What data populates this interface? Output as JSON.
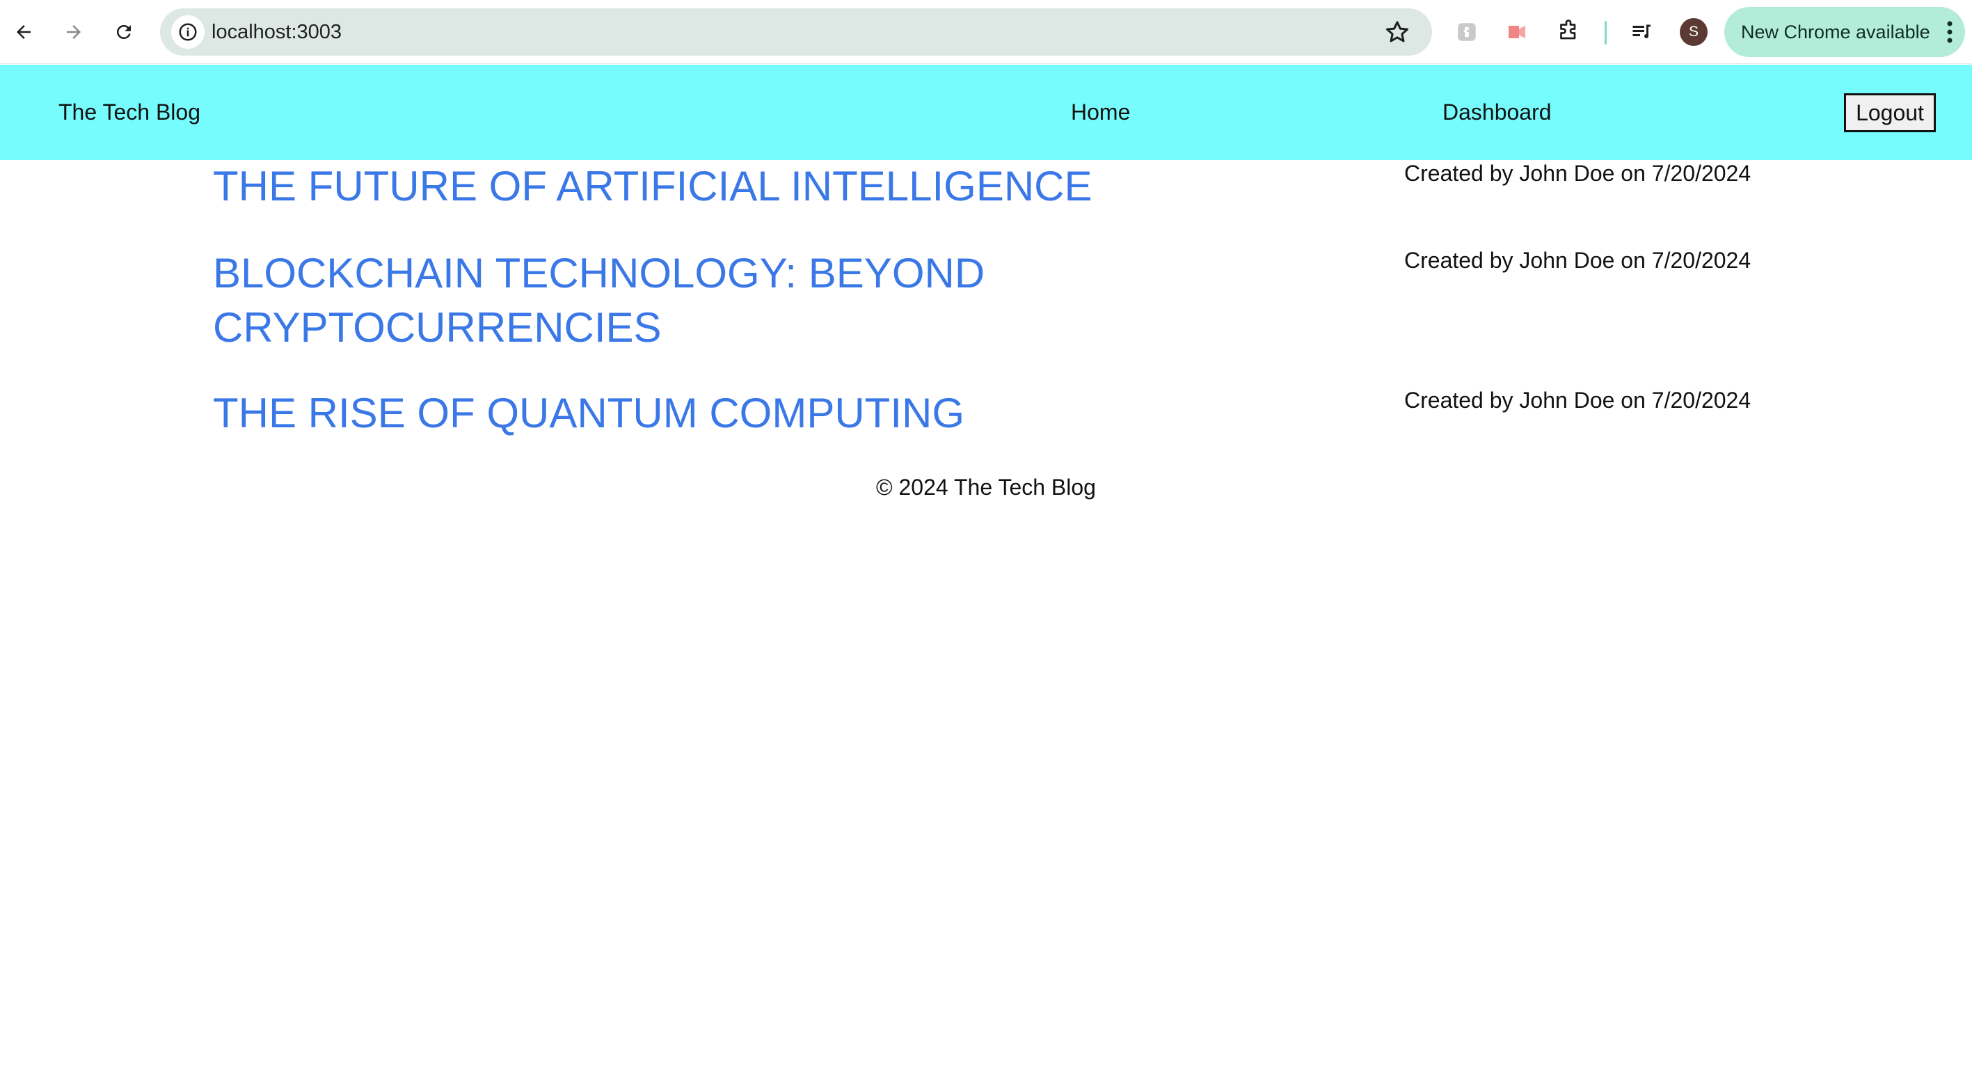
{
  "browser": {
    "url": "localhost:3003",
    "update_label": "New Chrome available",
    "profile_initial": "S",
    "accent_color": "#b3ecd9"
  },
  "header": {
    "brand": "The Tech Blog",
    "nav": [
      "Home",
      "Dashboard"
    ],
    "logout_label": "Logout",
    "background_color": "#76fcfc"
  },
  "posts": [
    {
      "title": "THE FUTURE OF ARTIFICIAL INTELLIGENCE",
      "meta": "Created by John Doe on 7/20/2024"
    },
    {
      "title": "BLOCKCHAIN TECHNOLOGY: BEYOND CRYPTOCURRENCIES",
      "meta": "Created by John Doe on 7/20/2024"
    },
    {
      "title": "THE RISE OF QUANTUM COMPUTING",
      "meta": "Created by John Doe on 7/20/2024"
    }
  ],
  "footer": {
    "text": "© 2024 The Tech Blog"
  },
  "colors": {
    "link": "#3b78e7"
  }
}
